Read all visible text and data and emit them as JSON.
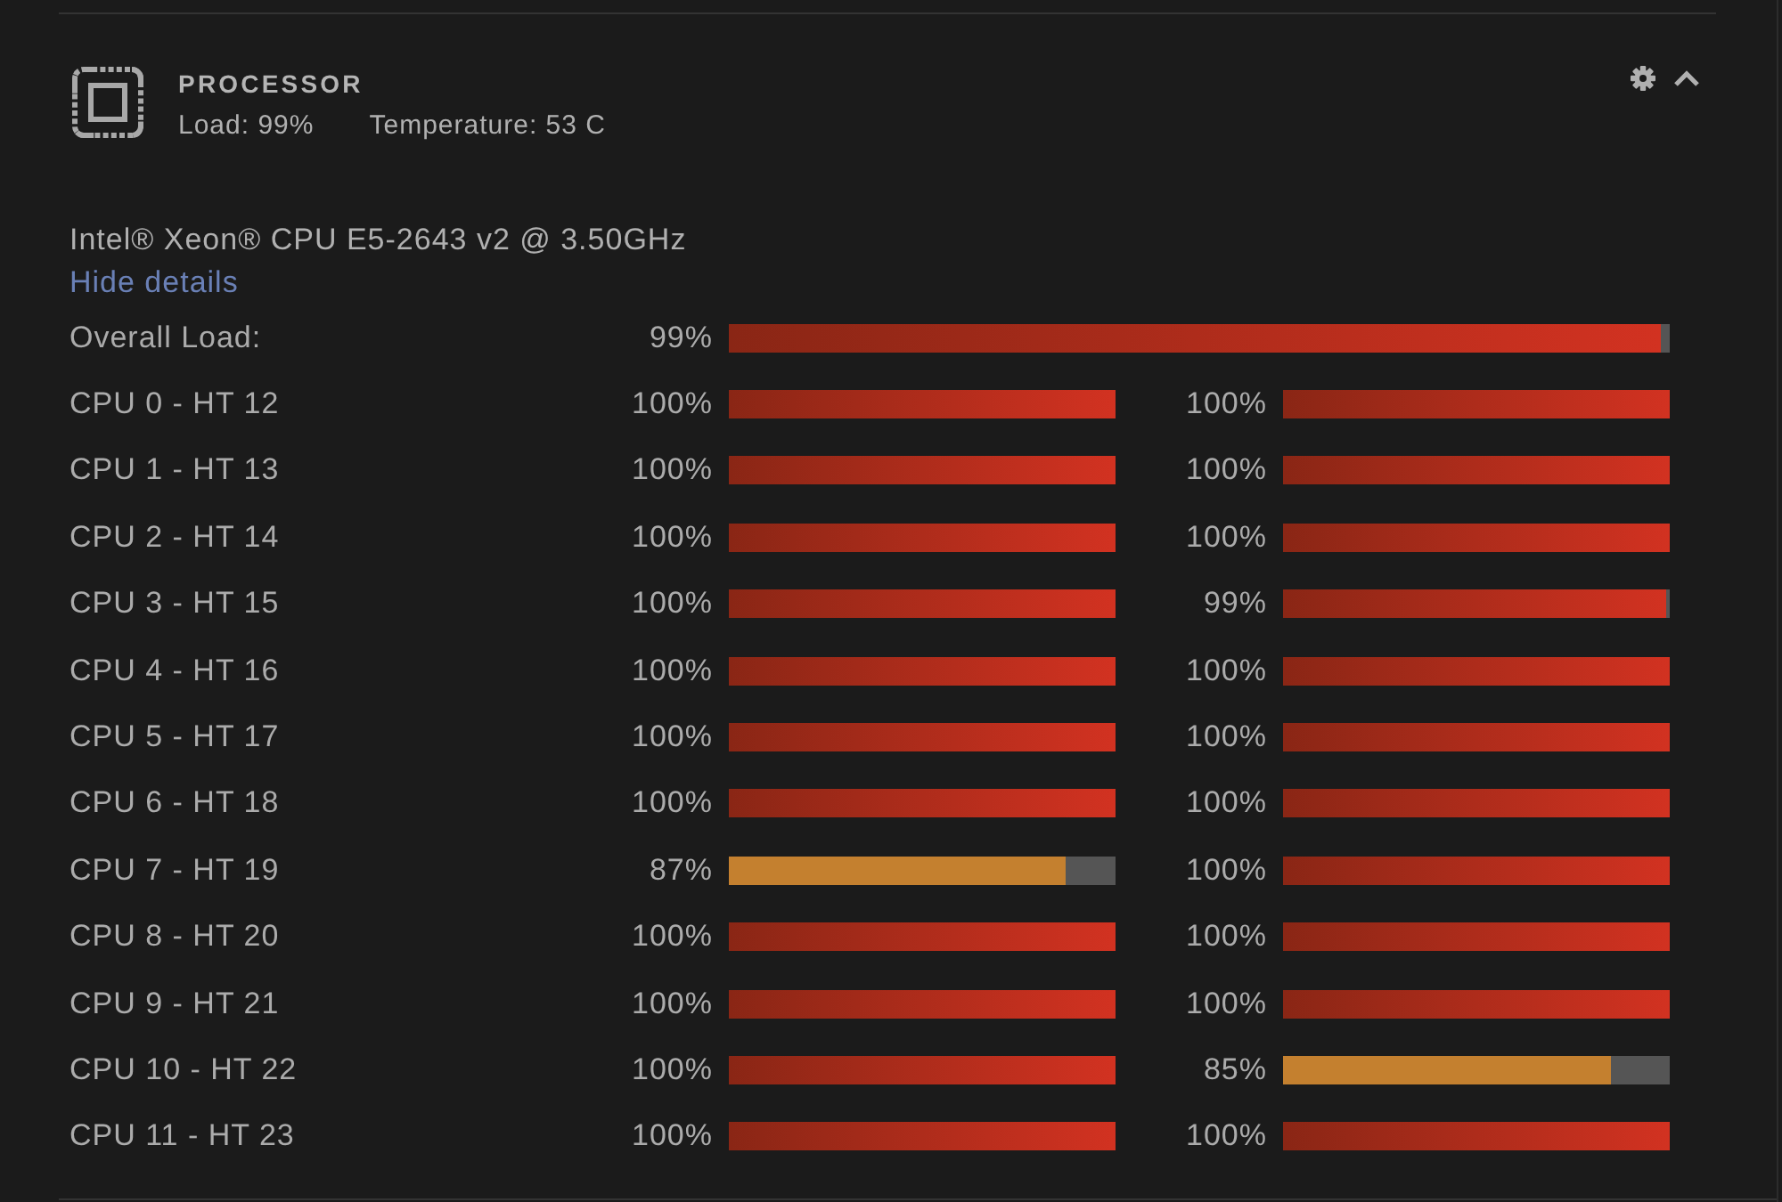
{
  "panel": {
    "title": "PROCESSOR",
    "load": "Load: 99%",
    "temperature": "Temperature: 53 C",
    "model": "Intel® Xeon® CPU E5-2643 v2 @ 3.50GHz",
    "details_link": "Hide details"
  },
  "overall": {
    "label": "Overall Load:",
    "reading": "99%",
    "level": 0.99
  },
  "cores": [
    {
      "label": "CPU 0 - HT 12",
      "threads": [
        {
          "reading": "100%",
          "level": 1
        },
        {
          "reading": "100%",
          "level": 1
        }
      ]
    },
    {
      "label": "CPU 1 - HT 13",
      "threads": [
        {
          "reading": "100%",
          "level": 1
        },
        {
          "reading": "100%",
          "level": 1
        }
      ]
    },
    {
      "label": "CPU 2 - HT 14",
      "threads": [
        {
          "reading": "100%",
          "level": 1
        },
        {
          "reading": "100%",
          "level": 1
        }
      ]
    },
    {
      "label": "CPU 3 - HT 15",
      "threads": [
        {
          "reading": "100%",
          "level": 1
        },
        {
          "reading": "99%",
          "level": 0.99
        }
      ]
    },
    {
      "label": "CPU 4 - HT 16",
      "threads": [
        {
          "reading": "100%",
          "level": 1
        },
        {
          "reading": "100%",
          "level": 1
        }
      ]
    },
    {
      "label": "CPU 5 - HT 17",
      "threads": [
        {
          "reading": "100%",
          "level": 1
        },
        {
          "reading": "100%",
          "level": 1
        }
      ]
    },
    {
      "label": "CPU 6 - HT 18",
      "threads": [
        {
          "reading": "100%",
          "level": 1
        },
        {
          "reading": "100%",
          "level": 1
        }
      ]
    },
    {
      "label": "CPU 7 - HT 19",
      "threads": [
        {
          "reading": "87%",
          "level": 0.87
        },
        {
          "reading": "100%",
          "level": 1
        }
      ]
    },
    {
      "label": "CPU 8 - HT 20",
      "threads": [
        {
          "reading": "100%",
          "level": 1
        },
        {
          "reading": "100%",
          "level": 1
        }
      ]
    },
    {
      "label": "CPU 9 - HT 21",
      "threads": [
        {
          "reading": "100%",
          "level": 1
        },
        {
          "reading": "100%",
          "level": 1
        }
      ]
    },
    {
      "label": "CPU 10 - HT 22",
      "threads": [
        {
          "reading": "100%",
          "level": 1
        },
        {
          "reading": "85%",
          "level": 0.85
        }
      ]
    },
    {
      "label": "CPU 11 - HT 23",
      "threads": [
        {
          "reading": "100%",
          "level": 1
        },
        {
          "reading": "100%",
          "level": 1
        }
      ]
    }
  ]
}
